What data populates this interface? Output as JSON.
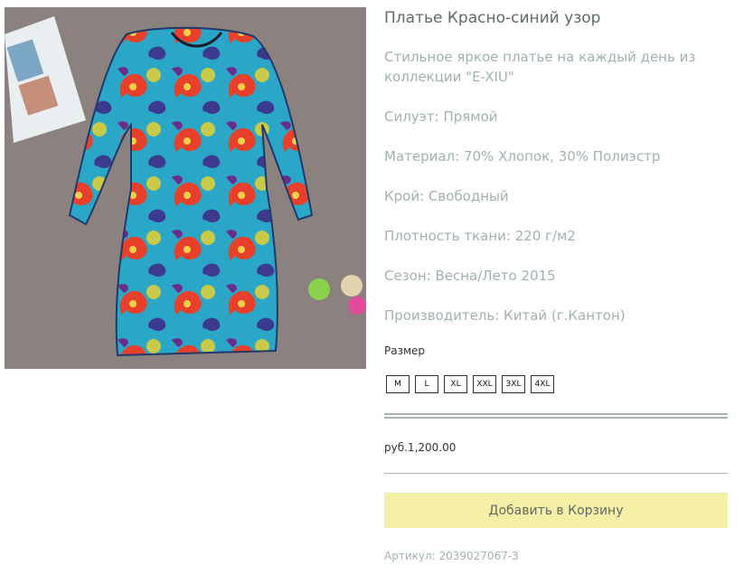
{
  "product": {
    "title": "Платье Красно-синий узор",
    "description": "Стильное яркое платье на каждый день из коллекции \"E-XIU\"",
    "specs": [
      "Силуэт: Прямой",
      "Материал: 70% Хлопок, 30% Полиэстр",
      "Крой: Свободный",
      "Плотность ткани: 220 г/м2",
      "Сезон: Весна/Лето 2015",
      "Производитель: Китай (г.Кантон)"
    ],
    "size_label": "Размер",
    "sizes": [
      "M",
      "L",
      "XL",
      "XXL",
      "3XL",
      "4XL"
    ],
    "price": "руб.1,200.00",
    "add_to_cart": "Добавить в Корзину",
    "sku": "Артикул: 2039027067-3"
  },
  "colors": {
    "accent_button": "#f6f0a7",
    "text_muted": "#a0b3ab",
    "title_text": "#5f6b67",
    "divider": "#a8b8b0"
  }
}
